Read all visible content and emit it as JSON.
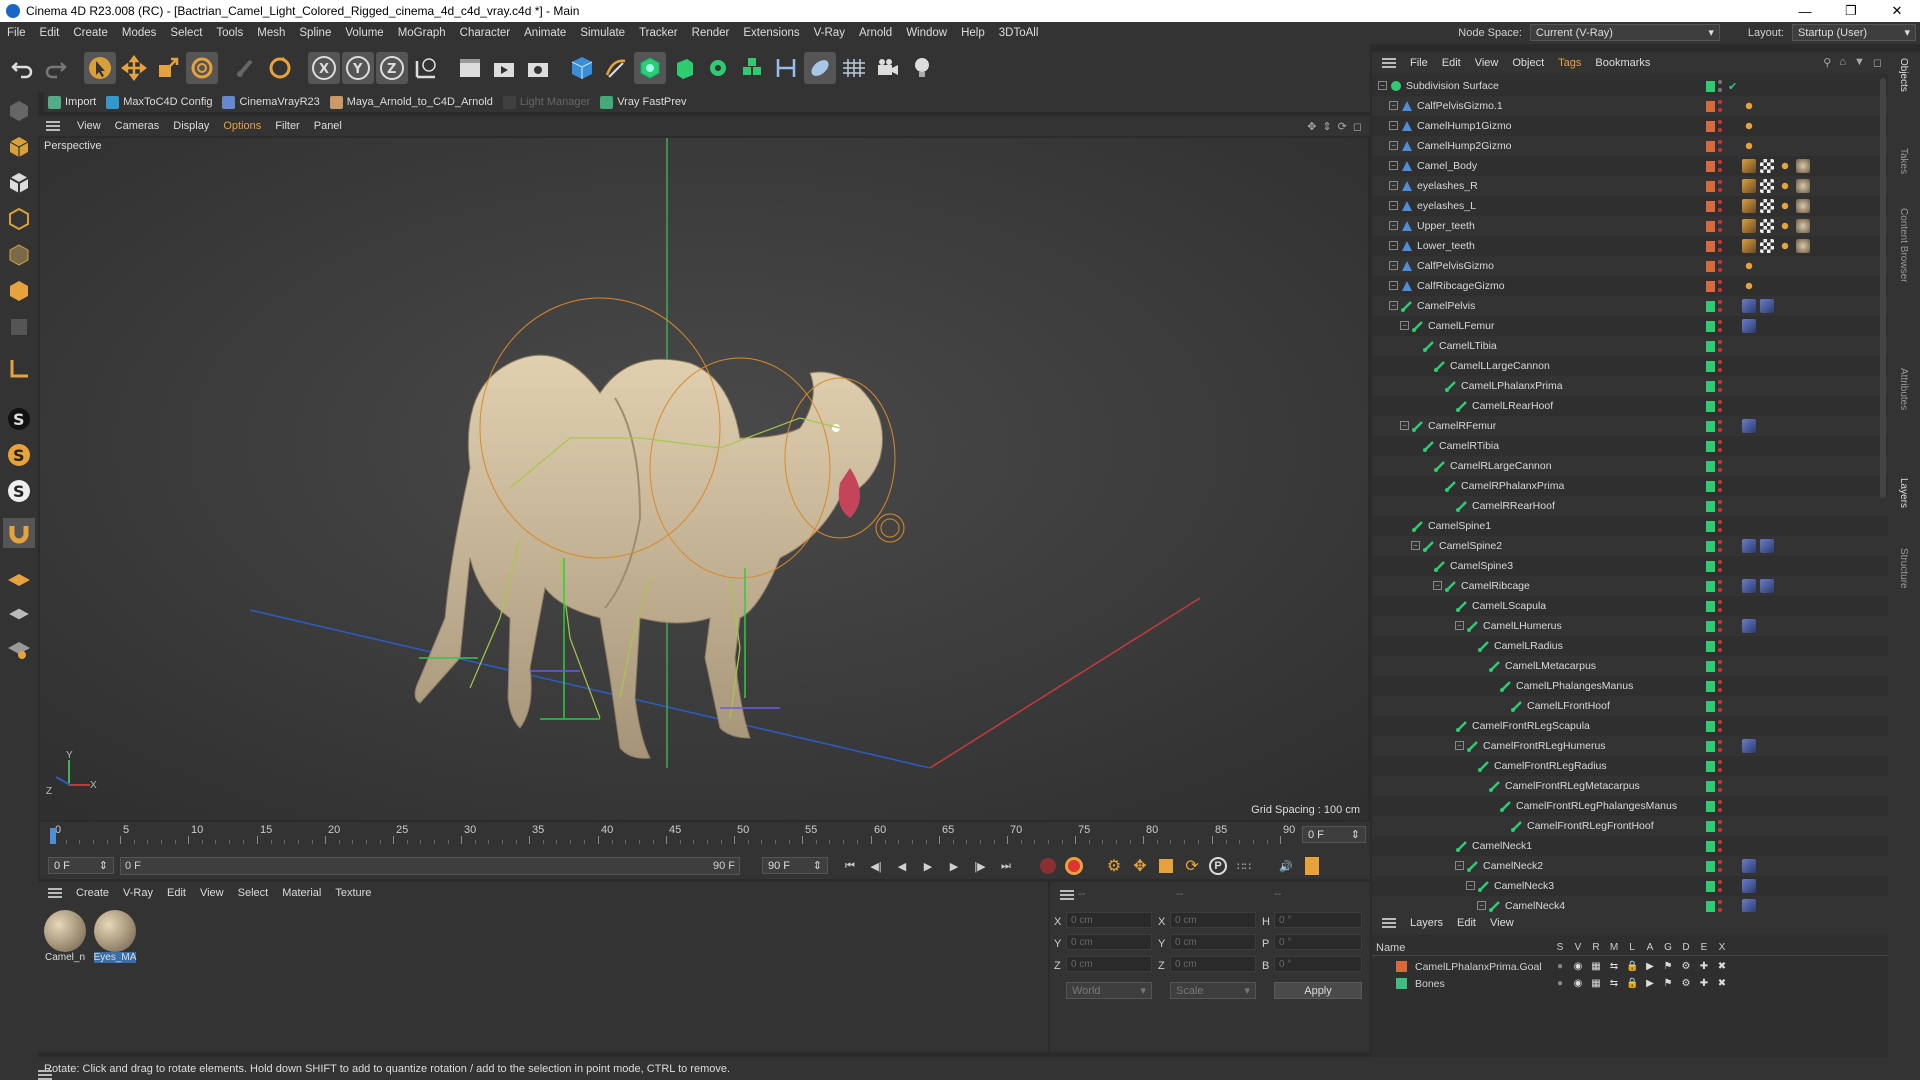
{
  "window": {
    "title": "Cinema 4D R23.008 (RC) - [Bactrian_Camel_Light_Colored_Rigged_cinema_4d_c4d_vray.c4d *] - Main"
  },
  "menu": [
    "File",
    "Edit",
    "Create",
    "Modes",
    "Select",
    "Tools",
    "Mesh",
    "Spline",
    "Volume",
    "MoGraph",
    "Character",
    "Animate",
    "Simulate",
    "Tracker",
    "Render",
    "Extensions",
    "V-Ray",
    "Arnold",
    "Window",
    "Help",
    "3DToAll"
  ],
  "nodespace": {
    "label": "Node Space:",
    "value": "Current (V-Ray)"
  },
  "layout": {
    "label": "Layout:",
    "value": "Startup (User)"
  },
  "plugins": [
    "Import",
    "MaxToC4D Config",
    "CinemaVrayR23",
    "Maya_Arnold_to_C4D_Arnold",
    "Light Manager",
    "Vray FastPrev"
  ],
  "viewport_menu": [
    "View",
    "Cameras",
    "Display",
    "Options",
    "Filter",
    "Panel"
  ],
  "viewport": {
    "label": "Perspective",
    "grid": "Grid Spacing : 100 cm",
    "axis_y": "Y",
    "axis_z": "Z",
    "axis_x": "X"
  },
  "timeline": {
    "ticks": [
      "0",
      "5",
      "10",
      "15",
      "20",
      "25",
      "30",
      "35",
      "40",
      "45",
      "50",
      "55",
      "60",
      "65",
      "70",
      "75",
      "80",
      "85",
      "90"
    ],
    "current": "0 F",
    "start": "0 F",
    "range_start": "0 F",
    "range_end": "90 F",
    "end": "90 F"
  },
  "material_menu": [
    "Create",
    "V-Ray",
    "Edit",
    "View",
    "Select",
    "Material",
    "Texture"
  ],
  "materials": [
    {
      "name": "Camel_n"
    },
    {
      "name": "Eyes_MA"
    }
  ],
  "coords": {
    "head": [
      "--",
      "--",
      "--"
    ],
    "x_pos": "0 cm",
    "y_pos": "0 cm",
    "z_pos": "0 cm",
    "x_size": "0 cm",
    "y_size": "0 cm",
    "z_size": "0 cm",
    "h": "0 °",
    "p": "0 °",
    "b": "0 °",
    "mode": "World",
    "size_mode": "Scale",
    "apply": "Apply",
    "labels": [
      "X",
      "Y",
      "Z",
      "X",
      "Y",
      "Z",
      "H",
      "P",
      "B"
    ]
  },
  "object_menu": [
    "File",
    "Edit",
    "View",
    "Object",
    "Tags",
    "Bookmarks"
  ],
  "objects": [
    {
      "name": "Subdivision Surface",
      "depth": 0,
      "kind": "sub",
      "tags": 0
    },
    {
      "name": "CalfPelvisGizmo.1",
      "depth": 1,
      "kind": "mesh",
      "tags": 1
    },
    {
      "name": "CamelHump1Gizmo",
      "depth": 1,
      "kind": "mesh",
      "tags": 1
    },
    {
      "name": "CamelHump2Gizmo",
      "depth": 1,
      "kind": "mesh",
      "tags": 1
    },
    {
      "name": "Camel_Body",
      "depth": 1,
      "kind": "mesh",
      "tags": 4
    },
    {
      "name": "eyelashes_R",
      "depth": 1,
      "kind": "mesh",
      "tags": 4
    },
    {
      "name": "eyelashes_L",
      "depth": 1,
      "kind": "mesh",
      "tags": 4
    },
    {
      "name": "Upper_teeth",
      "depth": 1,
      "kind": "mesh",
      "tags": 4
    },
    {
      "name": "Lower_teeth",
      "depth": 1,
      "kind": "mesh",
      "tags": 4
    },
    {
      "name": "CalfPelvisGizmo",
      "depth": 1,
      "kind": "mesh",
      "tags": 1
    },
    {
      "name": "CalfRibcageGizmo",
      "depth": 1,
      "kind": "mesh",
      "tags": 1
    },
    {
      "name": "CamelPelvis",
      "depth": 1,
      "kind": "bone",
      "tags": 2
    },
    {
      "name": "CamelLFemur",
      "depth": 2,
      "kind": "bone",
      "tags": 1
    },
    {
      "name": "CamelLTibia",
      "depth": 3,
      "kind": "bone",
      "tags": 0
    },
    {
      "name": "CamelLLargeCannon",
      "depth": 4,
      "kind": "bone",
      "tags": 0
    },
    {
      "name": "CamelLPhalanxPrima",
      "depth": 5,
      "kind": "bone",
      "tags": 0
    },
    {
      "name": "CamelLRearHoof",
      "depth": 6,
      "kind": "bone",
      "tags": 0
    },
    {
      "name": "CamelRFemur",
      "depth": 2,
      "kind": "bone",
      "tags": 1
    },
    {
      "name": "CamelRTibia",
      "depth": 3,
      "kind": "bone",
      "tags": 0
    },
    {
      "name": "CamelRLargeCannon",
      "depth": 4,
      "kind": "bone",
      "tags": 0
    },
    {
      "name": "CamelRPhalanxPrima",
      "depth": 5,
      "kind": "bone",
      "tags": 0
    },
    {
      "name": "CamelRRearHoof",
      "depth": 6,
      "kind": "bone",
      "tags": 0
    },
    {
      "name": "CamelSpine1",
      "depth": 2,
      "kind": "bone",
      "tags": 0
    },
    {
      "name": "CamelSpine2",
      "depth": 3,
      "kind": "bone",
      "tags": 2
    },
    {
      "name": "CamelSpine3",
      "depth": 4,
      "kind": "bone",
      "tags": 0
    },
    {
      "name": "CamelRibcage",
      "depth": 5,
      "kind": "bone",
      "tags": 2
    },
    {
      "name": "CamelLScapula",
      "depth": 6,
      "kind": "bone",
      "tags": 0
    },
    {
      "name": "CamelLHumerus",
      "depth": 7,
      "kind": "bone",
      "tags": 1
    },
    {
      "name": "CamelLRadius",
      "depth": 8,
      "kind": "bone",
      "tags": 0
    },
    {
      "name": "CamelLMetacarpus",
      "depth": 9,
      "kind": "bone",
      "tags": 0
    },
    {
      "name": "CamelLPhalangesManus",
      "depth": 10,
      "kind": "bone",
      "tags": 0
    },
    {
      "name": "CamelLFrontHoof",
      "depth": 11,
      "kind": "bone",
      "tags": 0
    },
    {
      "name": "CamelFrontRLegScapula",
      "depth": 6,
      "kind": "bone",
      "tags": 0
    },
    {
      "name": "CamelFrontRLegHumerus",
      "depth": 7,
      "kind": "bone",
      "tags": 1
    },
    {
      "name": "CamelFrontRLegRadius",
      "depth": 8,
      "kind": "bone",
      "tags": 0
    },
    {
      "name": "CamelFrontRLegMetacarpus",
      "depth": 9,
      "kind": "bone",
      "tags": 0
    },
    {
      "name": "CamelFrontRLegPhalangesManus",
      "depth": 10,
      "kind": "bone",
      "tags": 0
    },
    {
      "name": "CamelFrontRLegFrontHoof",
      "depth": 11,
      "kind": "bone",
      "tags": 0
    },
    {
      "name": "CamelNeck1",
      "depth": 6,
      "kind": "bone",
      "tags": 0
    },
    {
      "name": "CamelNeck2",
      "depth": 7,
      "kind": "bone",
      "tags": 1
    },
    {
      "name": "CamelNeck3",
      "depth": 8,
      "kind": "bone",
      "tags": 1
    },
    {
      "name": "CamelNeck4",
      "depth": 9,
      "kind": "bone",
      "tags": 1
    }
  ],
  "layers_menu": [
    "Layers",
    "Edit",
    "View"
  ],
  "layers_header": {
    "name": "Name",
    "cols": [
      "S",
      "V",
      "R",
      "M",
      "L",
      "A",
      "G",
      "D",
      "E",
      "X"
    ]
  },
  "layers": [
    {
      "name": "CamelLPhalanxPrima.Goal",
      "color": "#d9683a"
    },
    {
      "name": "Bones",
      "color": "#3fbf7f"
    }
  ],
  "right_tabs": [
    "Objects",
    "Takes",
    "Content Browser",
    "Attributes",
    "Layers",
    "Structure"
  ],
  "status": "Rotate: Click and drag to rotate elements. Hold down SHIFT to add to quantize rotation / add to the selection in point mode, CTRL to remove.",
  "colors": {
    "accent": "#e6a23c",
    "orange_dot": "#d9683a",
    "green_dot": "#2ecc71",
    "bg": "#333333"
  }
}
